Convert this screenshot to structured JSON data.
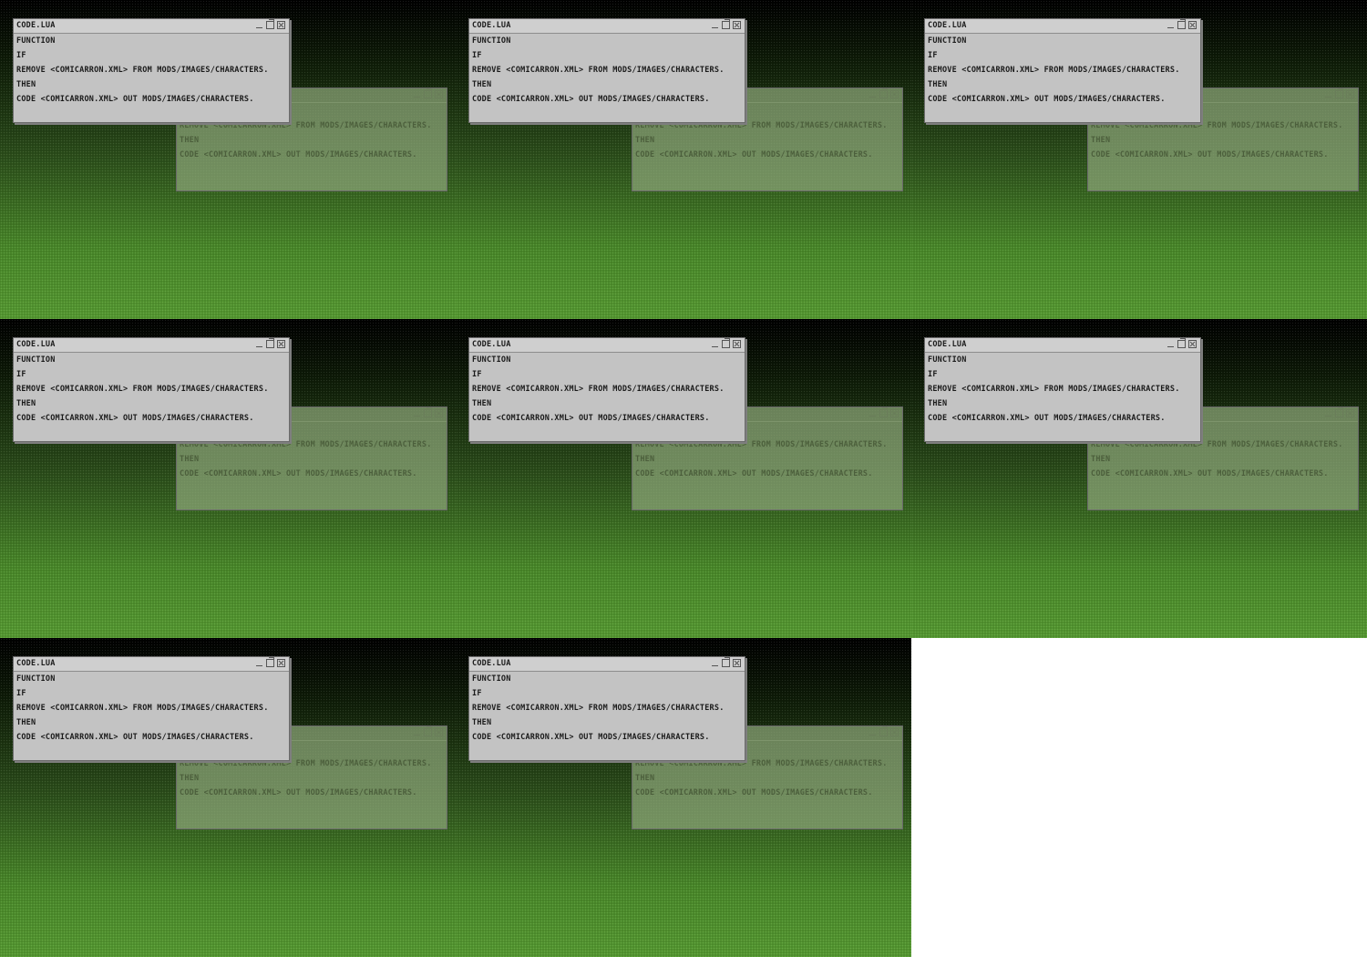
{
  "window": {
    "title": "CODE.LUA",
    "lines": [
      "FUNCTION",
      "IF",
      "REMOVE <COMICARRON.XML> FROM MODS/IMAGES/CHARACTERS.",
      "THEN",
      "CODE <COMICARRON.XML> OUT MODS/IMAGES/CHARACTERS."
    ]
  },
  "back_window": {
    "lines": [
      "IF",
      "REMOVE <COMICARRON.XML> FROM MODS/IMAGES/CHARACTERS.",
      "THEN",
      "CODE <COMICARRON.XML> OUT MODS/IMAGES/CHARACTERS."
    ]
  },
  "controls": {
    "minimize_icon": "minimize-icon",
    "maximize_icon": "maximize-icon",
    "close_icon": "close-icon"
  },
  "colors": {
    "window_face": "#c3c3c3",
    "background_top": "#000000",
    "background_bottom": "#569a32",
    "empty_area": "#ffffff"
  },
  "tile_count": 8
}
